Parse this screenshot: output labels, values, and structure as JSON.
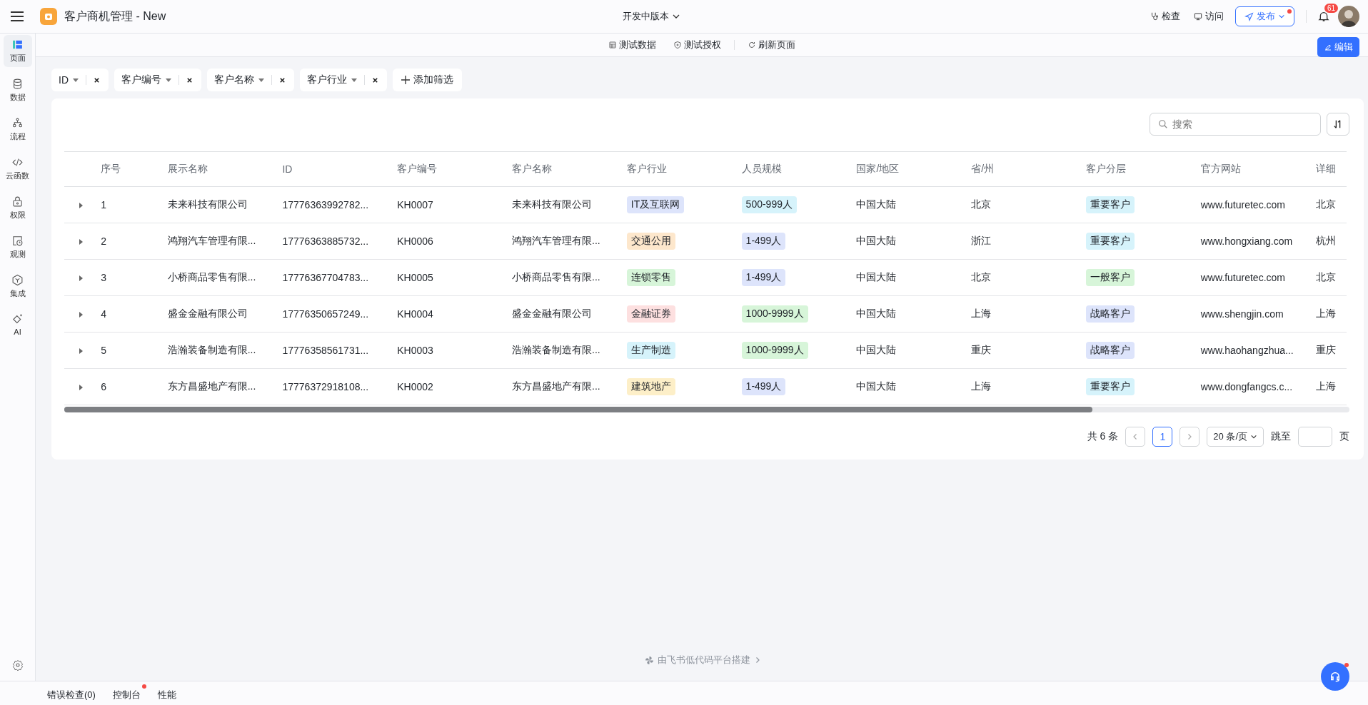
{
  "app": {
    "title": "客户商机管理 - New",
    "version": "开发中版本"
  },
  "header_actions": [
    {
      "label": "检查",
      "kind": "inspect"
    },
    {
      "label": "访问",
      "kind": "visit"
    }
  ],
  "publish": {
    "label": "发布",
    "has_dot": true
  },
  "notifications": {
    "count": "61"
  },
  "sidebar": {
    "items": [
      {
        "label": "页面",
        "selected": true
      },
      {
        "label": "数据",
        "selected": false
      },
      {
        "label": "流程",
        "selected": false
      },
      {
        "label": "云函数",
        "selected": false
      },
      {
        "label": "权限",
        "selected": false
      },
      {
        "label": "观测",
        "selected": false
      },
      {
        "label": "集成",
        "selected": false
      },
      {
        "label": "AI",
        "selected": false
      }
    ]
  },
  "toolbar": {
    "items": [
      "测试数据",
      "测试授权",
      "刷新页面"
    ],
    "edit": "编辑"
  },
  "filters": [
    {
      "label": "ID"
    },
    {
      "label": "客户编号"
    },
    {
      "label": "客户名称"
    },
    {
      "label": "客户行业"
    }
  ],
  "add_filter": "添加筛选",
  "search": {
    "placeholder": "搜索"
  },
  "table": {
    "columns": [
      "序号",
      "展示名称",
      "ID",
      "客户编号",
      "客户名称",
      "客户行业",
      "人员规模",
      "国家/地区",
      "省/州",
      "客户分层",
      "官方网站",
      "详细"
    ],
    "rows": [
      {
        "no": "1",
        "display_name": "未来科技有限公司",
        "id": "17776363992782...",
        "code": "KH0007",
        "name": "未来科技有限公司",
        "industry": {
          "text": "IT及互联网",
          "color": "#dde4fb"
        },
        "size": {
          "text": "500-999人",
          "color": "#d6f3fb"
        },
        "country": "中国大陆",
        "province": "北京",
        "tier": {
          "text": "重要客户",
          "color": "#d6f3fb"
        },
        "website": "www.futuretec.com",
        "column_12": "北京"
      },
      {
        "no": "2",
        "display_name": "鸿翔汽车管理有限...",
        "id": "17776363885732...",
        "code": "KH0006",
        "name": "鸿翔汽车管理有限...",
        "industry": {
          "text": "交通公用",
          "color": "#fde7cc"
        },
        "size": {
          "text": "1-499人",
          "color": "#dde4fb"
        },
        "country": "中国大陆",
        "province": "浙江",
        "tier": {
          "text": "重要客户",
          "color": "#d6f3fb"
        },
        "website": "www.hongxiang.com",
        "column_12": "杭州"
      },
      {
        "no": "3",
        "display_name": "小桥商品零售有限...",
        "id": "17776367704783...",
        "code": "KH0005",
        "name": "小桥商品零售有限...",
        "industry": {
          "text": "连锁零售",
          "color": "#d7f5d9"
        },
        "size": {
          "text": "1-499人",
          "color": "#dde4fb"
        },
        "country": "中国大陆",
        "province": "北京",
        "tier": {
          "text": "一般客户",
          "color": "#d7f5d9"
        },
        "website": "www.futuretec.com",
        "column_12": "北京"
      },
      {
        "no": "4",
        "display_name": "盛金金融有限公司",
        "id": "17776350657249...",
        "code": "KH0004",
        "name": "盛金金融有限公司",
        "industry": {
          "text": "金融证券",
          "color": "#fde0e0"
        },
        "size": {
          "text": "1000-9999人",
          "color": "#d7f5d9"
        },
        "country": "中国大陆",
        "province": "上海",
        "tier": {
          "text": "战略客户",
          "color": "#dde4fb"
        },
        "website": "www.shengjin.com",
        "column_12": "上海"
      },
      {
        "no": "5",
        "display_name": "浩瀚装备制造有限...",
        "id": "17776358561731...",
        "code": "KH0003",
        "name": "浩瀚装备制造有限...",
        "industry": {
          "text": "生产制造",
          "color": "#d6f3fb"
        },
        "size": {
          "text": "1000-9999人",
          "color": "#d7f5d9"
        },
        "country": "中国大陆",
        "province": "重庆",
        "tier": {
          "text": "战略客户",
          "color": "#dde4fb"
        },
        "website": "www.haohangzhua...",
        "column_12": "重庆"
      },
      {
        "no": "6",
        "display_name": "东方昌盛地产有限...",
        "id": "17776372918108...",
        "code": "KH0002",
        "name": "东方昌盛地产有限...",
        "industry": {
          "text": "建筑地产",
          "color": "#fdefc8"
        },
        "size": {
          "text": "1-499人",
          "color": "#dde4fb"
        },
        "country": "中国大陆",
        "province": "上海",
        "tier": {
          "text": "重要客户",
          "color": "#d6f3fb"
        },
        "website": "www.dongfangcs.c...",
        "column_12": "上海"
      }
    ]
  },
  "pagination": {
    "total": "共 6 条",
    "pages": [
      {
        "label": "1",
        "selected": true
      }
    ],
    "page_size": "20 条/页",
    "jump_label": "跳至",
    "jump_suffix": "页"
  },
  "footer": {
    "credit": "由飞书低代码平台搭建"
  },
  "bottom_tabs": [
    {
      "label": "错误检查(0)",
      "has_dot": false
    },
    {
      "label": "控制台",
      "has_dot": true
    },
    {
      "label": "性能",
      "has_dot": false
    }
  ]
}
